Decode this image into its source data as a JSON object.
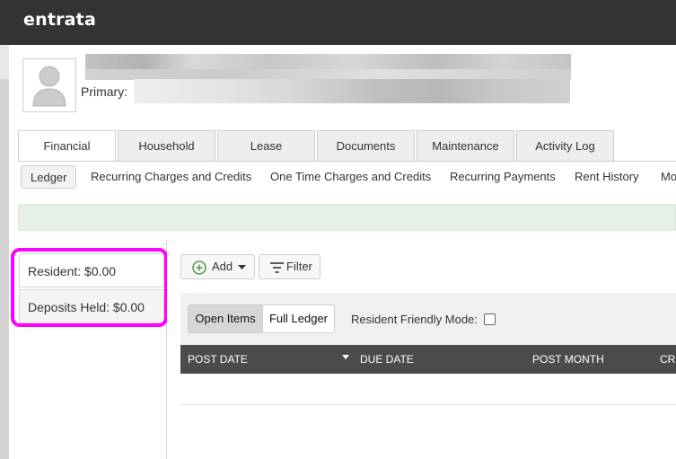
{
  "app": {
    "logo": "entrata"
  },
  "profile": {
    "primary_label": "Primary:"
  },
  "tabs": [
    {
      "label": "Financial",
      "active": true
    },
    {
      "label": "Household",
      "active": false
    },
    {
      "label": "Lease",
      "active": false
    },
    {
      "label": "Documents",
      "active": false
    },
    {
      "label": "Maintenance",
      "active": false
    },
    {
      "label": "Activity Log",
      "active": false
    }
  ],
  "subtabs": [
    {
      "label": "Ledger",
      "active": true
    },
    {
      "label": "Recurring Charges and Credits",
      "active": false
    },
    {
      "label": "One Time Charges and Credits",
      "active": false
    },
    {
      "label": "Recurring Payments",
      "active": false
    },
    {
      "label": "Rent History",
      "active": false
    },
    {
      "label": "Mo",
      "active": false
    }
  ],
  "balances": {
    "resident": "Resident: $0.00",
    "deposits_held": "Deposits Held: $0.00"
  },
  "toolbar": {
    "add_label": "Add",
    "filter_label": "Filter"
  },
  "view_toggle": {
    "open_items": "Open Items",
    "full_ledger": "Full Ledger",
    "selected": "Open Items"
  },
  "resident_friendly_mode": {
    "label": "Resident Friendly Mode:",
    "checked": false
  },
  "table": {
    "columns": [
      "POST DATE",
      "DUE DATE",
      "POST MONTH",
      "CRE"
    ],
    "sorted_column": "POST DATE"
  },
  "colors": {
    "topbar": "#333333",
    "highlight": "#ff00ff",
    "table_header": "#4b4b4b",
    "banner": "#e6efe6",
    "add_icon": "#3b8a3b"
  },
  "icons": [
    "avatar-placeholder-icon",
    "plus-circle-icon",
    "caret-down-icon",
    "filter-icon",
    "sort-desc-icon"
  ]
}
